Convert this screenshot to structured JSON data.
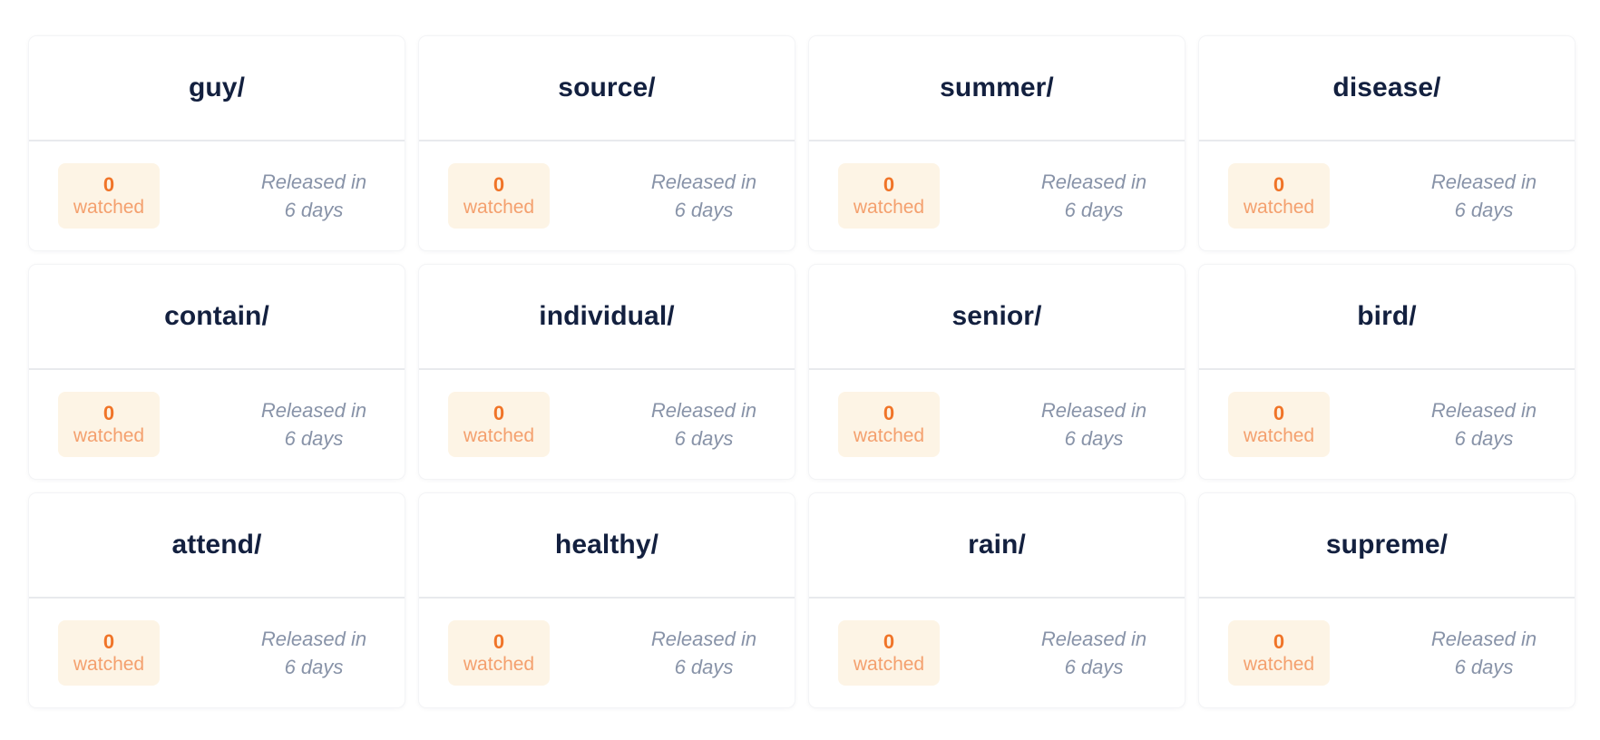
{
  "colors": {
    "title": "#13203f",
    "badge_background": "#fdf4e5",
    "badge_count": "#f07428",
    "badge_label": "#f4a06e",
    "release_text": "#8893a8",
    "divider": "#e8eaed"
  },
  "cards": [
    {
      "title": "guy/",
      "watched_count": "0",
      "watched_label": "watched",
      "release_line1": "Released in",
      "release_line2": "6 days"
    },
    {
      "title": "source/",
      "watched_count": "0",
      "watched_label": "watched",
      "release_line1": "Released in",
      "release_line2": "6 days"
    },
    {
      "title": "summer/",
      "watched_count": "0",
      "watched_label": "watched",
      "release_line1": "Released in",
      "release_line2": "6 days"
    },
    {
      "title": "disease/",
      "watched_count": "0",
      "watched_label": "watched",
      "release_line1": "Released in",
      "release_line2": "6 days"
    },
    {
      "title": "contain/",
      "watched_count": "0",
      "watched_label": "watched",
      "release_line1": "Released in",
      "release_line2": "6 days"
    },
    {
      "title": "individual/",
      "watched_count": "0",
      "watched_label": "watched",
      "release_line1": "Released in",
      "release_line2": "6 days"
    },
    {
      "title": "senior/",
      "watched_count": "0",
      "watched_label": "watched",
      "release_line1": "Released in",
      "release_line2": "6 days"
    },
    {
      "title": "bird/",
      "watched_count": "0",
      "watched_label": "watched",
      "release_line1": "Released in",
      "release_line2": "6 days"
    },
    {
      "title": "attend/",
      "watched_count": "0",
      "watched_label": "watched",
      "release_line1": "Released in",
      "release_line2": "6 days"
    },
    {
      "title": "healthy/",
      "watched_count": "0",
      "watched_label": "watched",
      "release_line1": "Released in",
      "release_line2": "6 days"
    },
    {
      "title": "rain/",
      "watched_count": "0",
      "watched_label": "watched",
      "release_line1": "Released in",
      "release_line2": "6 days"
    },
    {
      "title": "supreme/",
      "watched_count": "0",
      "watched_label": "watched",
      "release_line1": "Released in",
      "release_line2": "6 days"
    }
  ]
}
